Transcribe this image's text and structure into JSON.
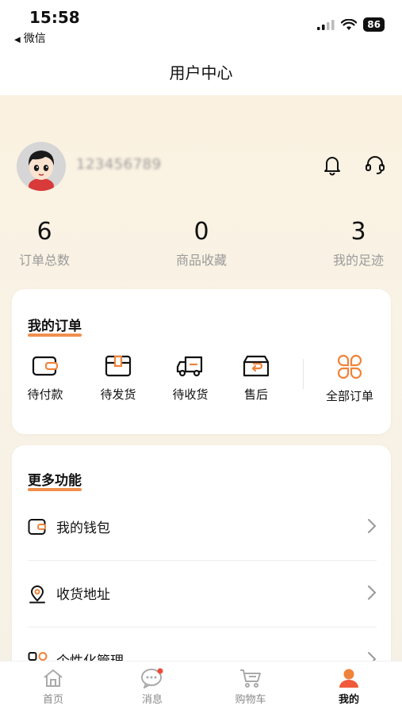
{
  "status_bar": {
    "time": "15:58",
    "back_label": "微信",
    "battery": "86"
  },
  "header": {
    "title": "用户中心"
  },
  "profile": {
    "user_id": "123456789"
  },
  "stats": [
    {
      "value": "6",
      "label": "订单总数"
    },
    {
      "value": "0",
      "label": "商品收藏"
    },
    {
      "value": "3",
      "label": "我的足迹"
    }
  ],
  "orders": {
    "title": "我的订单",
    "items": [
      {
        "label": "待付款",
        "icon": "wallet-icon"
      },
      {
        "label": "待发货",
        "icon": "package-icon"
      },
      {
        "label": "待收货",
        "icon": "truck-icon"
      },
      {
        "label": "售后",
        "icon": "return-box-icon"
      },
      {
        "label": "全部订单",
        "icon": "grid-clover-icon"
      }
    ]
  },
  "more": {
    "title": "更多功能",
    "items": [
      {
        "label": "我的钱包",
        "icon": "wallet-icon"
      },
      {
        "label": "收货地址",
        "icon": "location-pin-icon"
      },
      {
        "label": "个性化管理",
        "icon": "personalize-icon"
      }
    ]
  },
  "tabbar": {
    "items": [
      {
        "label": "首页",
        "icon": "home-icon"
      },
      {
        "label": "消息",
        "icon": "chat-icon"
      },
      {
        "label": "购物车",
        "icon": "cart-icon"
      },
      {
        "label": "我的",
        "icon": "person-icon"
      }
    ],
    "active_index": 3
  },
  "colors": {
    "accent": "#f0833a",
    "background": "#f7f1e3"
  }
}
